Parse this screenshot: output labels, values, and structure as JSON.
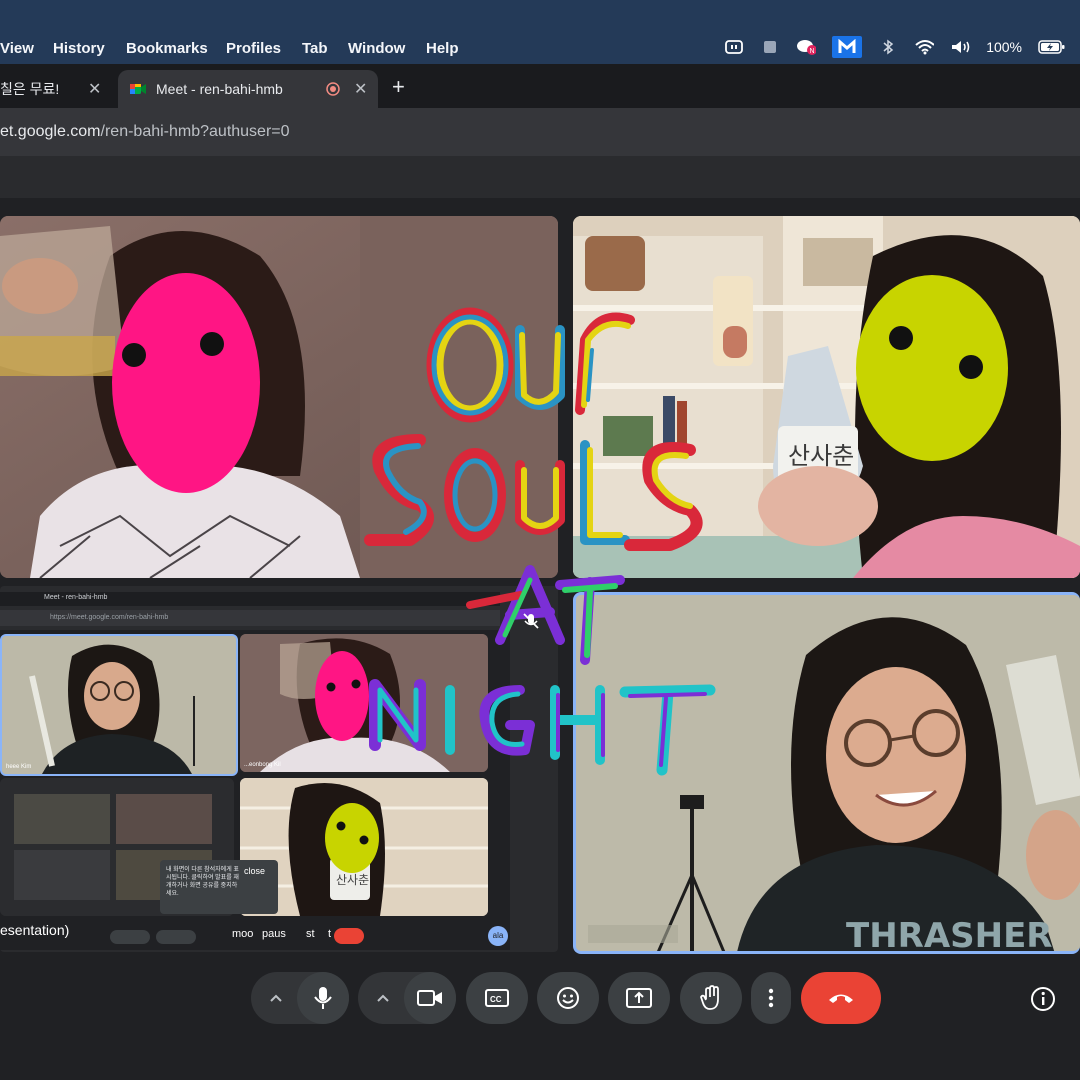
{
  "menubar": {
    "items": [
      "View",
      "History",
      "Bookmarks",
      "Profiles",
      "Tab",
      "Window",
      "Help"
    ],
    "battery": "100%",
    "icons": [
      "screen-record-icon",
      "app-square-icon",
      "chat-notification-icon",
      "malwarebytes-icon",
      "bluetooth-icon",
      "wifi-icon",
      "volume-icon",
      "battery-icon"
    ]
  },
  "tabs": {
    "prev_title": "칠은 무료!",
    "active_title": "Meet - ren-bahi-hmb",
    "new_tab": "+"
  },
  "address": {
    "host": "et.google.com",
    "path": "/ren-bahi-hmb?authuser=0"
  },
  "overlay_art": {
    "words": [
      "Our",
      "SOULS",
      "AT",
      "NIGHT"
    ]
  },
  "nested": {
    "tab_title": "Meet - ren-bahi-hmb",
    "url": "https://meet.google.com/ren-bahi-hmb",
    "name_tag_1": "heee Kim",
    "name_tag_2": "...eonbong Kil",
    "notice_text": "내 화면이 다른 참석자에게 표시됩니다. 클릭하여 발표를 재개하거나 화면 공유를 중지하세요.",
    "close_label": "close",
    "presentation_label": "esentation)",
    "bottom_labels": [
      "moo",
      "paus",
      "st",
      "t"
    ],
    "bottle_label": "산사춘",
    "avatar_initials": "ala"
  },
  "bottle_label": "산사춘",
  "shirt_text": "THRASHER",
  "controls": {
    "buttons": [
      "mic-chevron",
      "microphone",
      "camera-chevron",
      "camera",
      "captions",
      "emoji",
      "present-screen",
      "raise-hand",
      "more-options",
      "leave-call",
      "meeting-info"
    ]
  },
  "colors": {
    "menubar_bg": "#243a58",
    "accent_blue": "#8ab4f8",
    "leave_red": "#ea4335",
    "pink_face": "#ff1584",
    "lime_face": "#c8d400"
  }
}
